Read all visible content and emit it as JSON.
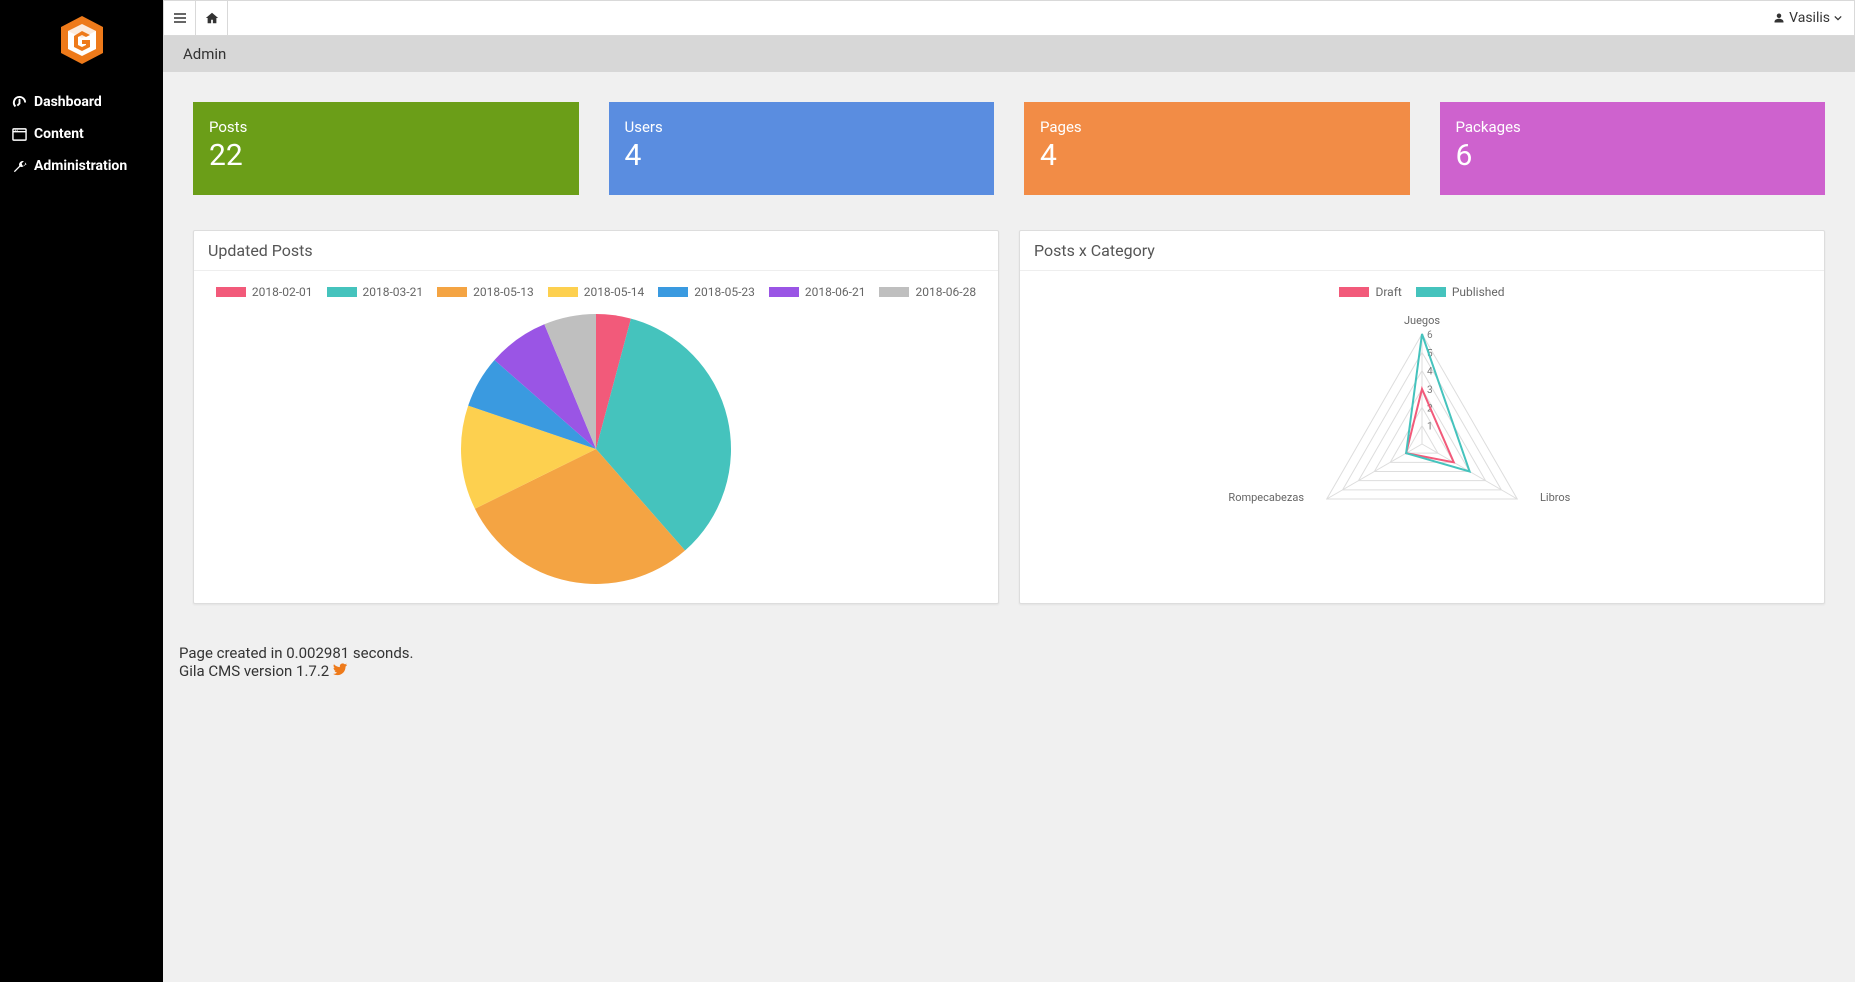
{
  "sidebar": {
    "items": [
      {
        "label": "Dashboard",
        "icon": "dashboard-icon"
      },
      {
        "label": "Content",
        "icon": "content-icon"
      },
      {
        "label": "Administration",
        "icon": "wrench-icon"
      }
    ]
  },
  "topbar": {
    "user": "Vasilis"
  },
  "breadcrumb": "Admin",
  "stats": [
    {
      "title": "Posts",
      "value": "22",
      "color": "green"
    },
    {
      "title": "Users",
      "value": "4",
      "color": "blue"
    },
    {
      "title": "Pages",
      "value": "4",
      "color": "orange"
    },
    {
      "title": "Packages",
      "value": "6",
      "color": "pink"
    }
  ],
  "panel_left_title": "Updated Posts",
  "panel_right_title": "Posts x Category",
  "footer": {
    "line1": "Page created in 0.002981 seconds.",
    "line2": "Gila CMS version 1.7.2"
  },
  "chart_data": [
    {
      "type": "pie",
      "title": "Updated Posts",
      "series": [
        {
          "name": "2018-02-01",
          "value": 4,
          "color": "#f25a7a"
        },
        {
          "name": "2018-03-21",
          "value": 33,
          "color": "#45c3bd"
        },
        {
          "name": "2018-05-13",
          "value": 28,
          "color": "#f4a443"
        },
        {
          "name": "2018-05-14",
          "value": 12,
          "color": "#fdd04f"
        },
        {
          "name": "2018-05-23",
          "value": 6,
          "color": "#3a9ae0"
        },
        {
          "name": "2018-06-21",
          "value": 7,
          "color": "#9a55e5"
        },
        {
          "name": "2018-06-28",
          "value": 6,
          "color": "#bfbfbf"
        }
      ]
    },
    {
      "type": "radar",
      "title": "Posts x Category",
      "axes": [
        "Juegos",
        "Libros",
        "Rompecabezas"
      ],
      "max": 6,
      "ticks": [
        1,
        2,
        3,
        4,
        5,
        6
      ],
      "series": [
        {
          "name": "Draft",
          "color": "#f25a7a",
          "values": [
            3,
            2,
            1
          ]
        },
        {
          "name": "Published",
          "color": "#45c3bd",
          "values": [
            6,
            3,
            1
          ]
        }
      ]
    }
  ]
}
